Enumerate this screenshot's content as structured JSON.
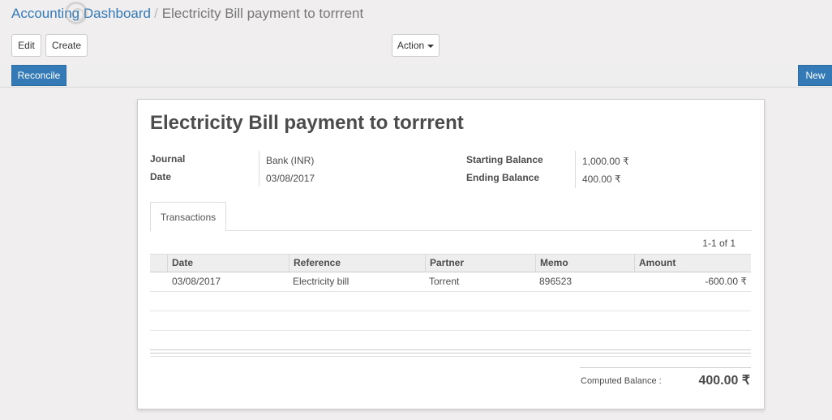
{
  "breadcrumb": {
    "parent": "Accounting Dashboard",
    "separator": "/",
    "current": "Electricity Bill payment to torrrent"
  },
  "toolbar": {
    "edit": "Edit",
    "create": "Create",
    "action": "Action"
  },
  "statusbar": {
    "reconcile": "Reconcile",
    "new": "New"
  },
  "record": {
    "title": "Electricity Bill payment to torrrent",
    "fields": {
      "journal_label": "Journal",
      "journal_value": "Bank (INR)",
      "date_label": "Date",
      "date_value": "03/08/2017",
      "starting_label": "Starting Balance",
      "starting_value": "1,000.00 ₹",
      "ending_label": "Ending Balance",
      "ending_value": "400.00 ₹"
    },
    "tabs": [
      {
        "label": "Transactions"
      }
    ],
    "pager": "1-1 of 1",
    "table": {
      "columns": [
        "Date",
        "Reference",
        "Partner",
        "Memo",
        "Amount"
      ],
      "rows": [
        {
          "date": "03/08/2017",
          "reference": "Electricity bill",
          "partner": "Torrent",
          "memo": "896523",
          "amount": "-600.00 ₹"
        }
      ]
    },
    "computed_label": "Computed Balance :",
    "computed_value": "400.00 ₹"
  },
  "colors": {
    "primary": "#337ab7",
    "background": "#f0eeee",
    "link": "#337ab7"
  }
}
